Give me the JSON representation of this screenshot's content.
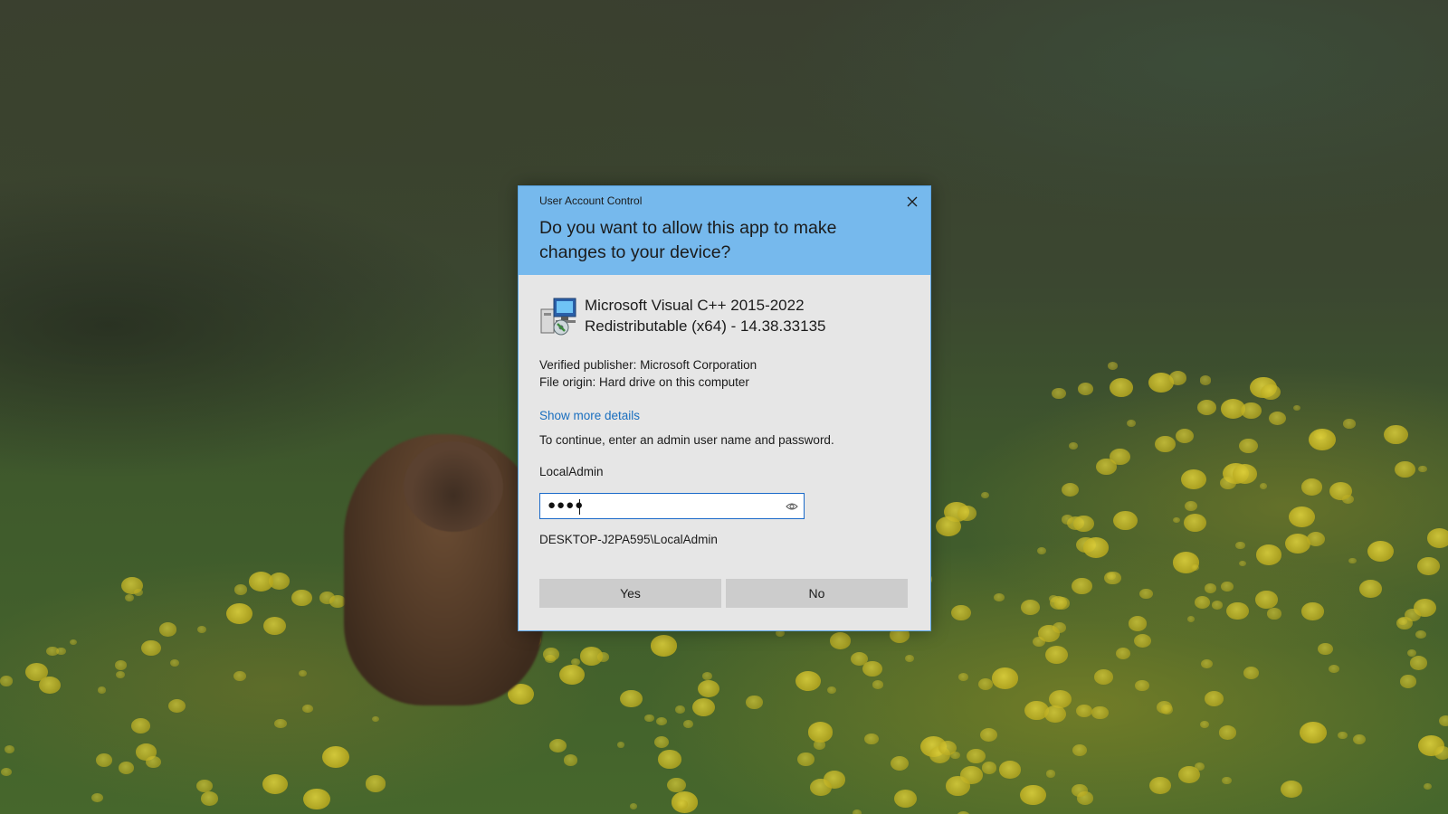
{
  "dialog": {
    "caption": "User Account Control",
    "question": "Do you want to allow this app to make changes to your device?",
    "app_name": "Microsoft Visual C++ 2015-2022 Redistributable (x64) - 14.38.33135",
    "verified_publisher": "Verified publisher: Microsoft Corporation",
    "file_origin": "File origin: Hard drive on this computer",
    "show_more_details": "Show more details",
    "continue_prompt": "To continue, enter an admin user name and password.",
    "username": "LocalAdmin",
    "password_masked": "●●●●",
    "domain_user": "DESKTOP-J2PA595\\LocalAdmin",
    "yes_label": "Yes",
    "no_label": "No"
  },
  "icons": {
    "close": "close-icon",
    "app": "installer-icon",
    "reveal": "eye-icon"
  },
  "colors": {
    "header": "#76b9ed",
    "dialog_body": "#e6e6e6",
    "link": "#1a6fbf",
    "button": "#cccccc",
    "input_border": "#1b6ac9"
  }
}
